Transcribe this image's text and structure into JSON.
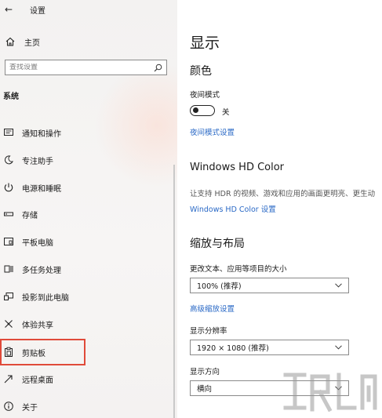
{
  "window": {
    "title": "设置"
  },
  "sidebar": {
    "home_label": "主页",
    "search_placeholder": "查找设置",
    "section_label": "系统",
    "items": [
      {
        "label": "通知和操作",
        "icon": "notification-icon"
      },
      {
        "label": "专注助手",
        "icon": "moon-icon"
      },
      {
        "label": "电源和睡眠",
        "icon": "power-icon"
      },
      {
        "label": "存储",
        "icon": "storage-icon"
      },
      {
        "label": "平板电脑",
        "icon": "tablet-icon"
      },
      {
        "label": "多任务处理",
        "icon": "multitask-icon"
      },
      {
        "label": "投影到此电脑",
        "icon": "project-icon"
      },
      {
        "label": "体验共享",
        "icon": "share-icon"
      },
      {
        "label": "剪贴板",
        "icon": "clipboard-icon",
        "highlighted": true
      },
      {
        "label": "远程桌面",
        "icon": "remote-desktop-icon"
      },
      {
        "label": "关于",
        "icon": "info-icon"
      }
    ]
  },
  "main": {
    "page_title": "显示",
    "color_heading": "颜色",
    "night_mode_label": "夜间模式",
    "night_mode_state": "关",
    "night_mode_settings_link": "夜间模式设置",
    "hdr_heading": "Windows HD Color",
    "hdr_desc": "让支持 HDR 的视频、游戏和应用的画面更明亮、更生动",
    "hdr_link": "Windows HD Color 设置",
    "scale_heading": "缩放与布局",
    "scale_label": "更改文本、应用等项目的大小",
    "scale_value": "100% (推荐)",
    "advanced_scale_link": "高级缩放设置",
    "resolution_label": "显示分辨率",
    "resolution_value": "1920 × 1080 (推荐)",
    "orientation_label": "显示方向",
    "orientation_value": "横向"
  },
  "colors": {
    "accent_link": "#2a69c6",
    "highlight_border": "#e04a3a"
  }
}
